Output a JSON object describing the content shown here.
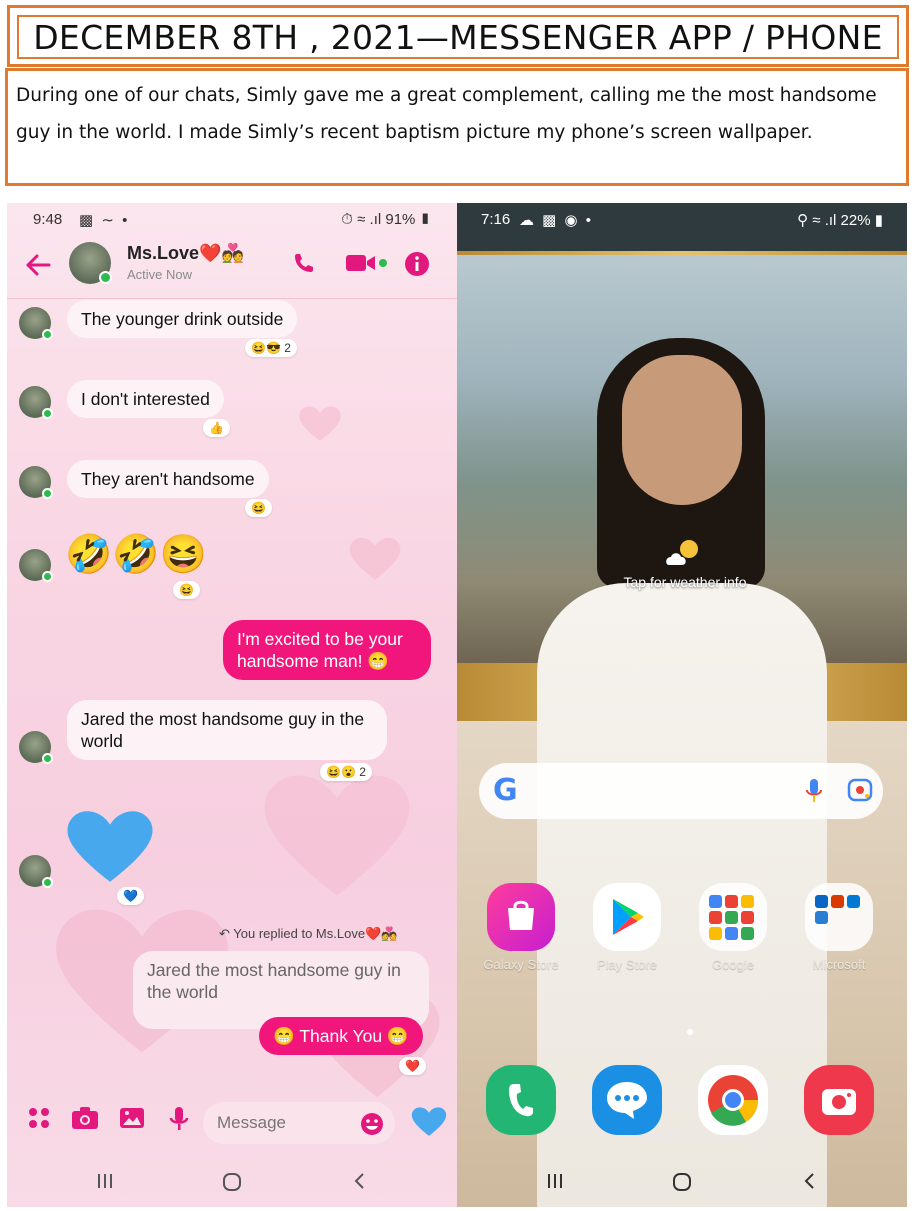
{
  "header": {
    "title": "DECEMBER 8TH , 2021—MESSENGER APP / PHONE",
    "description": "During one of our chats, Simly gave me a great complement, calling me the most handsome guy in the world. I made Simly’s recent baptism picture my phone’s screen wallpaper."
  },
  "messenger": {
    "status_bar": {
      "time": "9:48",
      "battery": "91%"
    },
    "contact": {
      "name": "Ms.Love",
      "name_emoji": "❤️💑",
      "status": "Active Now"
    },
    "messages": [
      {
        "side": "received",
        "text": "The younger drink outside",
        "reaction": "😆😎 2"
      },
      {
        "side": "received",
        "text": "I don't interested",
        "reaction": "👍"
      },
      {
        "side": "received",
        "text": "They aren't handsome",
        "reaction": "😆"
      },
      {
        "side": "received",
        "emoji": "🤣🤣😆",
        "reaction": "😆"
      },
      {
        "side": "sent",
        "text": "I'm excited to be your handsome man! 😁"
      },
      {
        "side": "received",
        "text": "Jared the most handsome guy in the world",
        "reaction": "😆😮 2"
      },
      {
        "side": "received",
        "emoji": "💙",
        "reaction": "💙"
      }
    ],
    "reply": {
      "note": "You replied to Ms.Love",
      "note_emoji": "❤️💑",
      "quoted": "Jared the most handsome guy in the world",
      "text": "😁 Thank You 😁",
      "reaction": "❤️"
    },
    "composer": {
      "placeholder": "Message"
    },
    "colors": {
      "accent": "#f0167c",
      "bubble_received": "#fdf3f6",
      "background": "#f9d6e3"
    }
  },
  "home_screen": {
    "status_bar": {
      "time": "7:16",
      "battery": "22%"
    },
    "weather": {
      "label": "Tap for weather info"
    },
    "apps": [
      {
        "label": "Galaxy Store",
        "icon": "galaxy-store-icon"
      },
      {
        "label": "Play Store",
        "icon": "play-store-icon"
      },
      {
        "label": "Google",
        "icon": "google-folder-icon"
      },
      {
        "label": "Microsoft",
        "icon": "microsoft-folder-icon"
      }
    ],
    "dock": [
      {
        "icon": "phone-icon"
      },
      {
        "icon": "messages-icon"
      },
      {
        "icon": "chrome-icon"
      },
      {
        "icon": "camera-icon"
      }
    ]
  }
}
